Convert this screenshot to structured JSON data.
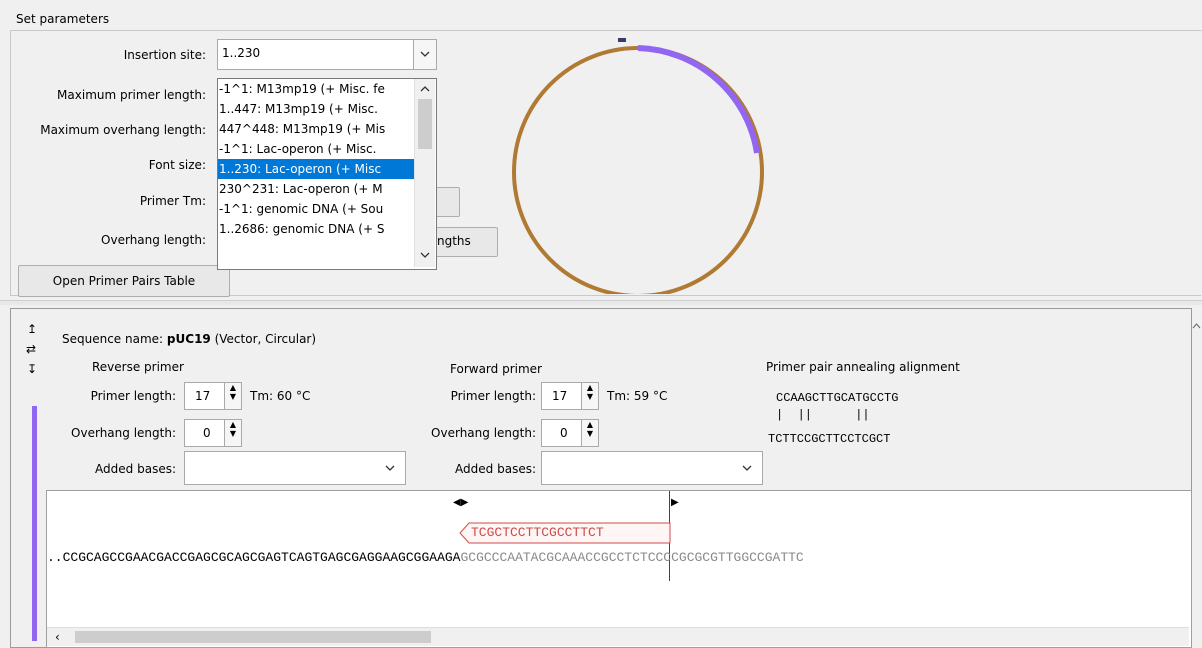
{
  "panel": {
    "title": "Set parameters"
  },
  "params": {
    "insertion_site_label": "Insertion site:",
    "insertion_site_value": "1..230",
    "max_primer_label": "Maximum primer length:",
    "max_overhang_label": "Maximum overhang length:",
    "font_size_label": "Font size:",
    "primer_tm_label": "Primer Tm:",
    "overhang_label": "Overhang length:",
    "lengths_btn_tail": "ngths",
    "open_table_btn": "Open Primer Pairs Table"
  },
  "dropdown": {
    "items": [
      "-1^1: M13mp19 (+ Misc. fe",
      "1..447: M13mp19 (+ Misc.",
      "447^448: M13mp19 (+ Mis",
      "-1^1: Lac-operon (+ Misc.",
      "1..230: Lac-operon (+ Misc",
      "230^231: Lac-operon (+ M",
      "-1^1: genomic DNA (+ Sou",
      "1..2686: genomic DNA (+ S"
    ],
    "selected_index": 4
  },
  "colors": {
    "accent_purple": "#9166f0",
    "arc_brown": "#b07a33",
    "highlight_blue": "#0078d7",
    "primer_red": "#cc4b4b"
  },
  "sequence": {
    "name_label": "Sequence name:",
    "name": "pUC19",
    "name_detail": "(Vector, Circular)"
  },
  "reverse": {
    "title": "Reverse primer",
    "primer_length_label": "Primer length:",
    "primer_length": "17",
    "tm": "Tm: 60 °C",
    "overhang_label": "Overhang length:",
    "overhang": "0",
    "added_label": "Added bases:"
  },
  "forward": {
    "title": "Forward primer",
    "primer_length_label": "Primer length:",
    "primer_length": "17",
    "tm": "Tm: 59 °C",
    "overhang_label": "Overhang length:",
    "overhang": "0",
    "added_label": "Added bases:"
  },
  "alignment": {
    "title": "Primer pair annealing alignment",
    "top": "CCAAGCTTGCATGCCTG",
    "bars": "|  ||      ||",
    "bottom": "TCTTCCGCTTCCTCGCT"
  },
  "seqview": {
    "primer": "TCGCTCCTTCGCCTTCT",
    "seq_bold": "..CCGCAGCCGAACGACCGAGCGCAGCGAGTCAGTGAGCGAGGAAGCGGAAGA",
    "seq_grey": "GCGCCCAATACGCAAACCGCCTCTCCCCGCGCGTTGGCCGATTC"
  }
}
